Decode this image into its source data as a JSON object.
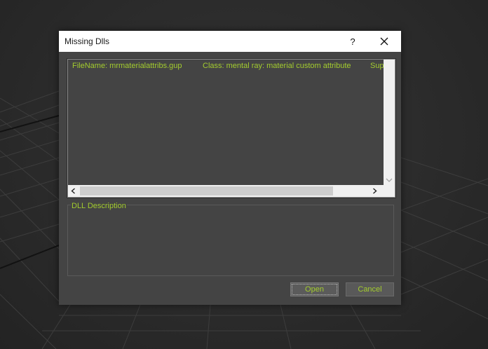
{
  "dialog": {
    "title": "Missing Dlls",
    "help_label": "?",
    "close_icon": "close-icon"
  },
  "dll_list": {
    "rows": [
      {
        "filename": "FileName:  mrmaterialattribs.gup",
        "class": "Class: mental ray: material custom attribute",
        "extra": "Sup"
      }
    ]
  },
  "description": {
    "label": "DLL Description",
    "text": ""
  },
  "buttons": {
    "open_label": "Open",
    "cancel_label": "Cancel"
  },
  "colors": {
    "text_accent": "#a3cc2e",
    "panel_bg": "#444444",
    "titlebar_bg": "#ffffff"
  }
}
